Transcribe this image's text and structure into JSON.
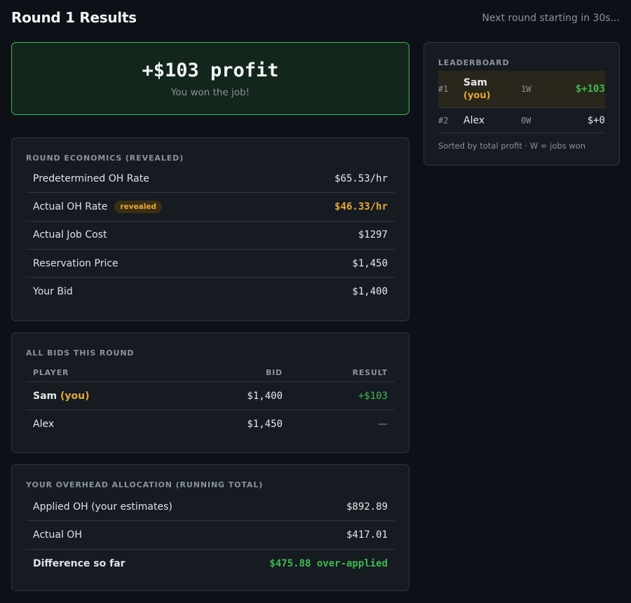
{
  "header": {
    "title": "Round 1 Results",
    "countdown": "Next round starting in 30s..."
  },
  "banner": {
    "amount": "+$103 profit",
    "message": "You won the job!"
  },
  "economics": {
    "label": "ROUND ECONOMICS (REVEALED)",
    "rows": [
      {
        "label": "Predetermined OH Rate",
        "value": "$65.53/hr"
      },
      {
        "label": "Actual OH Rate",
        "badge": "revealed",
        "value": "$46.33/hr"
      },
      {
        "label": "Actual Job Cost",
        "value": "$1297"
      },
      {
        "label": "Reservation Price",
        "value": "$1,450"
      },
      {
        "label": "Your Bid",
        "value": "$1,400"
      }
    ]
  },
  "bids": {
    "label": "ALL BIDS THIS ROUND",
    "columns": {
      "player": "PLAYER",
      "bid": "BID",
      "result": "RESULT"
    },
    "rows": [
      {
        "player": "Sam",
        "you": "(you)",
        "bid": "$1,400",
        "result": "+$103"
      },
      {
        "player": "Alex",
        "bid": "$1,450",
        "result": "—"
      }
    ]
  },
  "overhead": {
    "label": "YOUR OVERHEAD ALLOCATION (RUNNING TOTAL)",
    "rows": [
      {
        "label": "Applied OH (your estimates)",
        "value": "$892.89"
      },
      {
        "label": "Actual OH",
        "value": "$417.01"
      },
      {
        "label": "Difference so far",
        "value": "$475.88 over-applied"
      }
    ]
  },
  "leaderboard": {
    "label": "LEADERBOARD",
    "rows": [
      {
        "rank": "#1",
        "name": "Sam",
        "you": "(you)",
        "wins": "1W",
        "profit": "$+103"
      },
      {
        "rank": "#2",
        "name": "Alex",
        "wins": "0W",
        "profit": "$+0"
      }
    ],
    "note": "Sorted by total profit · W = jobs won"
  },
  "colors": {
    "background": "#0d1117",
    "card": "#161b22",
    "accent_green": "#3fb950",
    "accent_orange": "#e3a935"
  }
}
